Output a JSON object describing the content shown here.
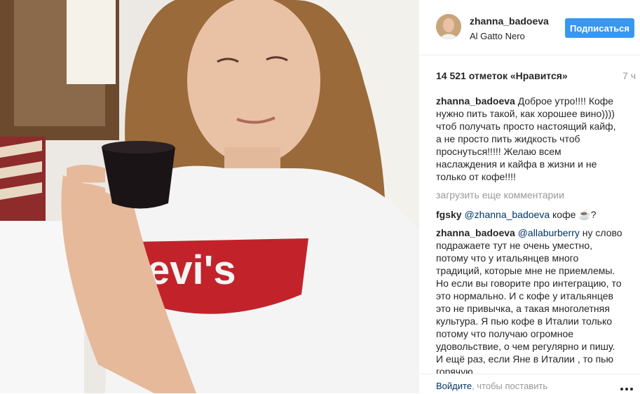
{
  "post": {
    "username": "zhanna_badoeva",
    "location": "Al Gatto Nero",
    "follow_label": "Подписаться",
    "likes": "14 521 отметок «Нравится»",
    "time": "7 ч"
  },
  "comments": [
    {
      "user": "zhanna_badoeva",
      "mention": "",
      "text": "Доброе утро!!!! Кофе нужно пить такой, как хорошее вино)))) чтоб получать просто настоящий кайф, а не просто пить жидкость чтоб проснуться!!!!! Желаю всем наслаждения и кайфа в жизни и не только от кофе!!!!"
    },
    {
      "user": "fgsky",
      "mention": "@zhanna_badoeva",
      "text": "кофе ☕?"
    },
    {
      "user": "zhanna_badoeva",
      "mention": "@allaburberry",
      "text": "ну слово подражаете тут не очень уместно, потому что у итальянцев много традиций, которые мне не приемлемы. Но если вы говорите про интеграцию, то это нормально. И с кофе у итальянцев это не привычка, а такая многолетняя культура. Я пью кофе в Италии только потому что получаю огромное удовольствие, о чем регулярно и пишу. И ещё раз, если Яне в Италии , то пью горячую"
    }
  ],
  "load_more": "загрузить еще комментарии",
  "footer": {
    "login_link": "Войдите",
    "login_text": ", чтобы поставить"
  },
  "photo": {
    "shirt_text": "evi's"
  }
}
